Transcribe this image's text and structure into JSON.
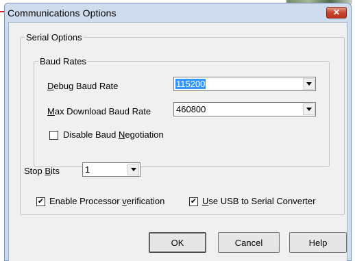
{
  "window": {
    "title": "Communications Options",
    "close_glyph": "✕"
  },
  "serial_options": {
    "legend": "Serial Options",
    "baud_rates": {
      "legend": "Baud Rates",
      "debug_label_accel": "D",
      "debug_label_rest": "ebug Baud Rate",
      "debug_value": "115200",
      "max_label_accel": "M",
      "max_label_rest": "ax Download Baud Rate",
      "max_value": "460800",
      "disable_neg_label_pre": "Disable Baud ",
      "disable_neg_label_accel": "N",
      "disable_neg_label_post": "egotiation",
      "disable_neg_checked": false
    },
    "stop_bits": {
      "label_pre": "Stop ",
      "label_accel": "B",
      "label_post": "its",
      "value": "1"
    },
    "enable_proc_verif": {
      "label_pre": "Enable Processor ",
      "label_accel": "v",
      "label_post": "erification",
      "checked": true
    },
    "use_usb": {
      "label_accel": "U",
      "label_post": "se USB to Serial Converter",
      "checked": true
    }
  },
  "buttons": {
    "ok": "OK",
    "cancel": "Cancel",
    "help": "Help"
  },
  "check_glyph": "✔"
}
